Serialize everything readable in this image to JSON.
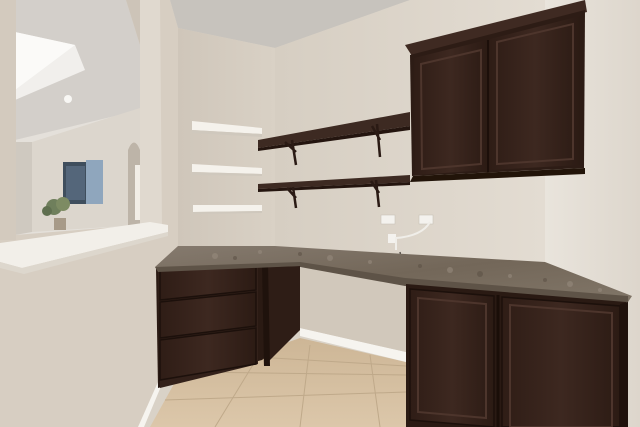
{
  "scene": {
    "subject": "built-in-desk-nook",
    "colors": {
      "wall_left": "#d8d0c4",
      "wall_back": "#ddd5ca",
      "wall_right": "#e6e0d7",
      "ceiling": "#c9c4bd",
      "cabinet": "#3a2620",
      "cabinet_dark": "#27170f",
      "cabinet_edge": "#4e362d",
      "countertop": "#7a6f63",
      "floor_tile": "#d4bfa1",
      "shelf_white": "#f3f0ea",
      "shelf_dark": "#3b2821",
      "trim": "#f6f4ef"
    }
  }
}
